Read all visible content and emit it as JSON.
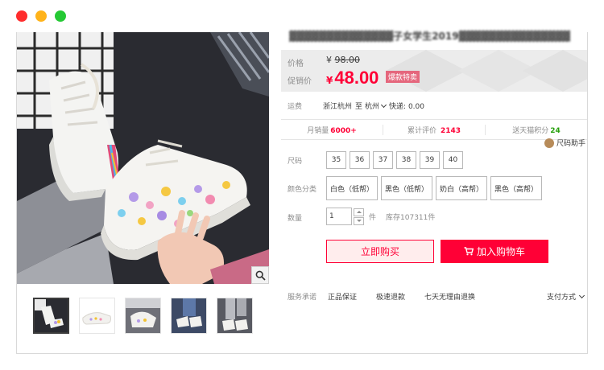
{
  "window_dots": [
    "#ff2d2d",
    "#ffb31a",
    "#25c934"
  ],
  "product": {
    "title": "▓▓▓▓▓▓▓▓▓▓▓▓▓▓子女学生2019▓▓▓▓▓▓▓▓▓▓▓▓▓▓▓",
    "price_label": "价格",
    "original_currency": "¥",
    "original_price": "98.00",
    "promo_label": "促销价",
    "promo_currency": "¥",
    "promo_price": "48.00",
    "promo_badge": "爆款特卖"
  },
  "shipping": {
    "label": "运费",
    "from": "浙江杭州",
    "to_word": "至",
    "to": "杭州",
    "express": "快递: 0.00"
  },
  "stats": {
    "monthly_sales_label": "月销量",
    "monthly_sales": "6000+",
    "reviews_label": "累计评价",
    "reviews": "2143",
    "points_label": "送天猫积分",
    "points": "24"
  },
  "size_helper": "尺码助手",
  "size": {
    "label": "尺码",
    "options": [
      "35",
      "36",
      "37",
      "38",
      "39",
      "40"
    ]
  },
  "color": {
    "label": "颜色分类",
    "options": [
      "白色（低帮）",
      "黑色（低帮）",
      "奶白（高帮）",
      "黑色（高帮）"
    ]
  },
  "quantity": {
    "label": "数量",
    "value": "1",
    "unit": "件",
    "stock": "库存107311件"
  },
  "actions": {
    "buy_now": "立即购买",
    "add_to_cart": "加入购物车"
  },
  "promise": {
    "label": "服务承诺",
    "items": [
      "正品保证",
      "极速退款",
      "七天无理由退换"
    ],
    "payment": "支付方式"
  },
  "icons": {
    "zoom": "magnifier-icon",
    "cart": "cart-icon",
    "size_helper": "ruler-badge-icon"
  },
  "colors": {
    "accent": "#ff0036",
    "badge": "#e5677d",
    "points": "#27a00d"
  }
}
